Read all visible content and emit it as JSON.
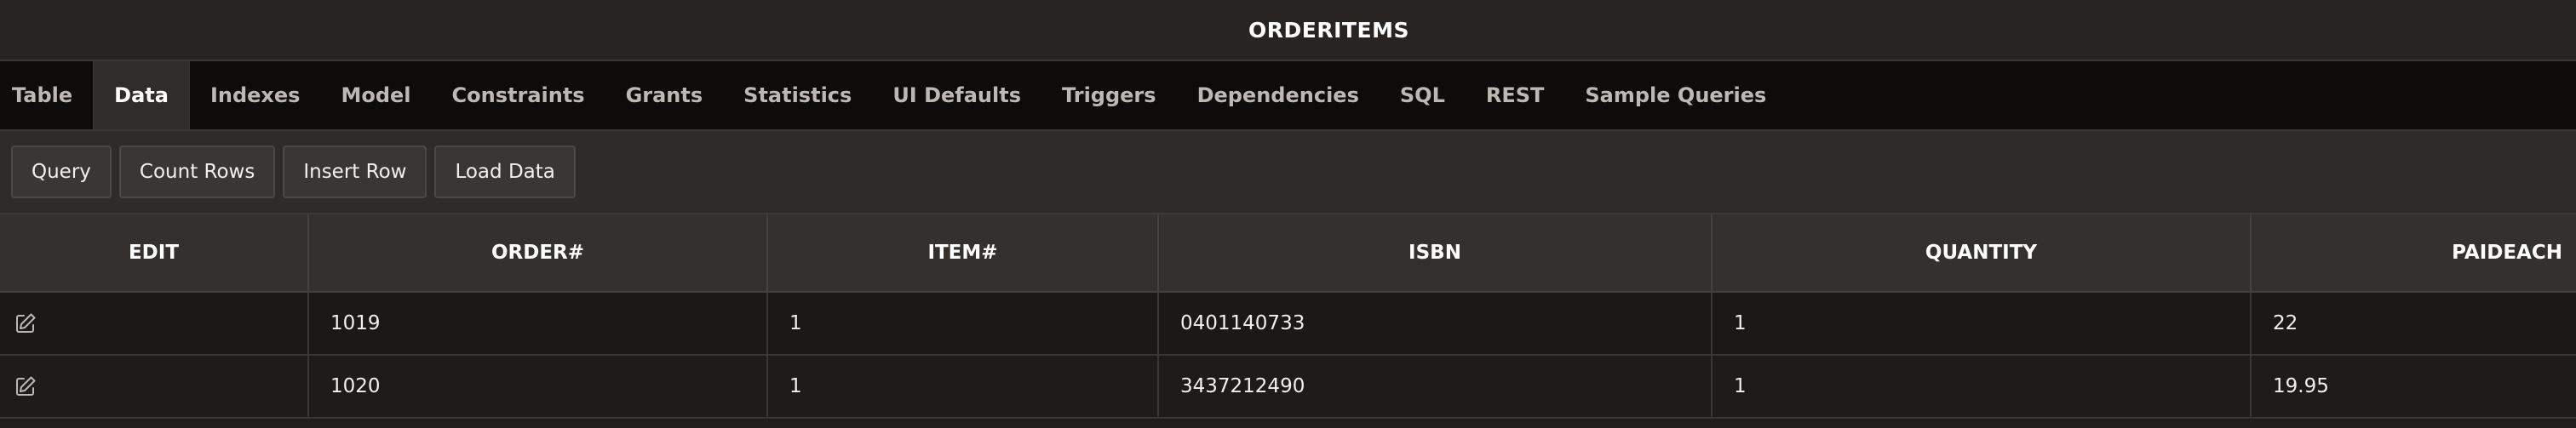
{
  "window": {
    "title": "ORDERITEMS"
  },
  "tabs": [
    {
      "label": "Table",
      "active": false
    },
    {
      "label": "Data",
      "active": true
    },
    {
      "label": "Indexes",
      "active": false
    },
    {
      "label": "Model",
      "active": false
    },
    {
      "label": "Constraints",
      "active": false
    },
    {
      "label": "Grants",
      "active": false
    },
    {
      "label": "Statistics",
      "active": false
    },
    {
      "label": "UI Defaults",
      "active": false
    },
    {
      "label": "Triggers",
      "active": false
    },
    {
      "label": "Dependencies",
      "active": false
    },
    {
      "label": "SQL",
      "active": false
    },
    {
      "label": "REST",
      "active": false
    },
    {
      "label": "Sample Queries",
      "active": false
    }
  ],
  "toolbar": {
    "query_label": "Query",
    "count_rows_label": "Count Rows",
    "insert_row_label": "Insert Row",
    "load_data_label": "Load Data"
  },
  "table": {
    "columns": [
      "EDIT",
      "ORDER#",
      "ITEM#",
      "ISBN",
      "QUANTITY",
      "PAIDEACH"
    ],
    "rows": [
      {
        "edit_icon": "edit-icon",
        "order": "1019",
        "item": "1",
        "isbn": "0401140733",
        "quantity": "1",
        "paideach": "22"
      },
      {
        "edit_icon": "edit-icon",
        "order": "1020",
        "item": "1",
        "isbn": "3437212490",
        "quantity": "1",
        "paideach": "19.95"
      }
    ]
  },
  "colors": {
    "background": "#201d1b",
    "tabbar": "#0d0c0b",
    "active_tab": "#302c29",
    "toolbar": "#2e2b28",
    "header": "#33302d"
  }
}
